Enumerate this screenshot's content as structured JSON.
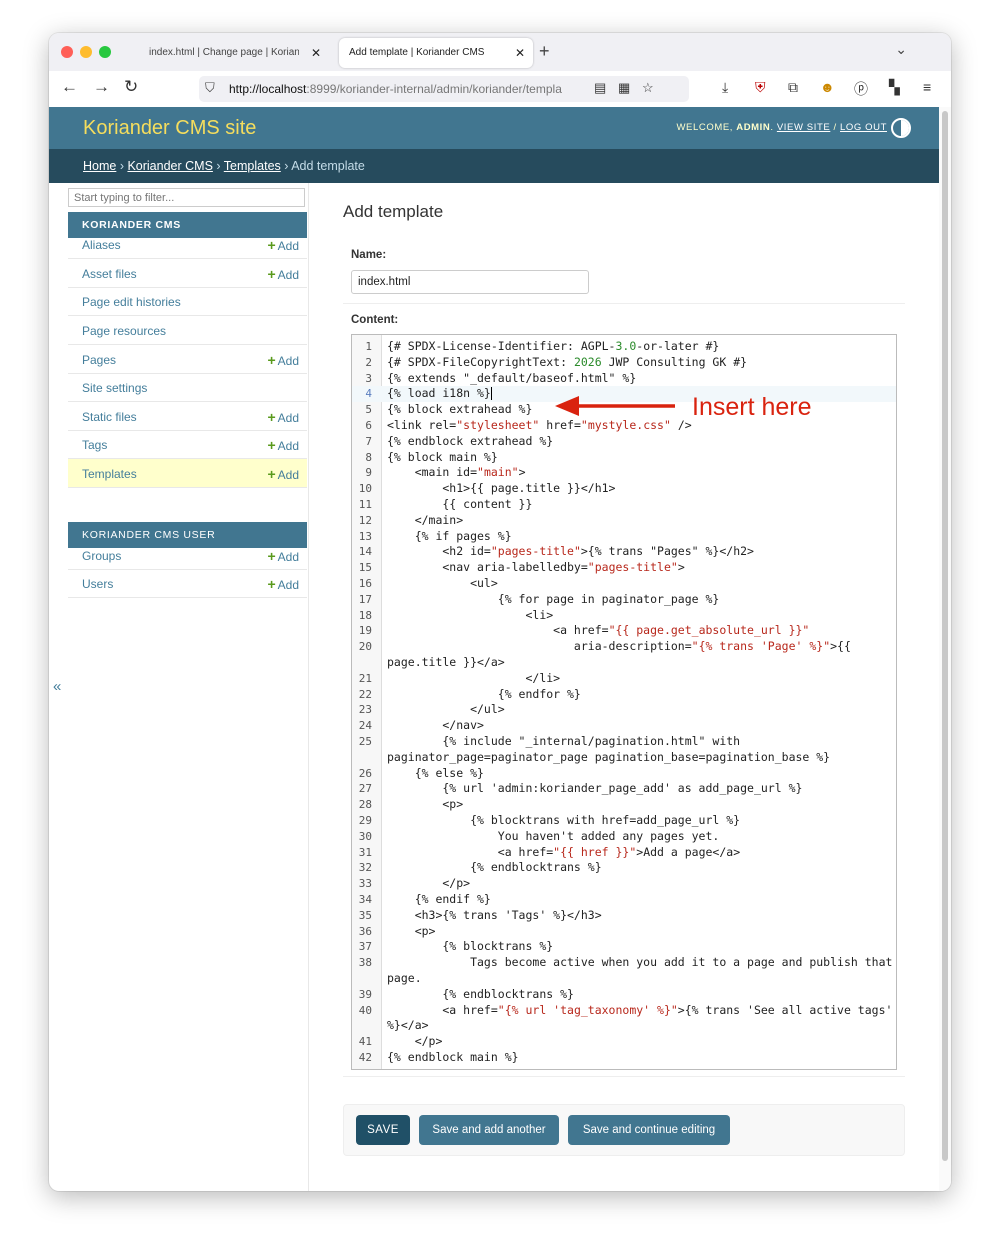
{
  "browser": {
    "tabs": [
      {
        "title": "index.html | Change page | Koriander CMS",
        "active": false
      },
      {
        "title": "Add template | Koriander CMS",
        "active": true
      }
    ],
    "url_host": "http://localhost",
    "url_rest": ":8999/koriander-internal/admin/koriander/templa"
  },
  "header": {
    "brand": "Koriander CMS site",
    "welcome": "WELCOME, ",
    "user": "ADMIN",
    "view_site": "VIEW SITE",
    "slash": " / ",
    "log_out": "LOG OUT"
  },
  "breadcrumbs": {
    "home": "Home",
    "app": "Koriander CMS",
    "model": "Templates",
    "sep": " › ",
    "current": "Add template"
  },
  "sidebar": {
    "filter_placeholder": "Start typing to filter...",
    "add_label": "Add",
    "sections": [
      {
        "caption": "KORIANDER CMS",
        "items": [
          {
            "name": "Aliases",
            "add": true
          },
          {
            "name": "Asset files",
            "add": true
          },
          {
            "name": "Page edit histories",
            "add": false
          },
          {
            "name": "Page resources",
            "add": false
          },
          {
            "name": "Pages",
            "add": true
          },
          {
            "name": "Site settings",
            "add": false
          },
          {
            "name": "Static files",
            "add": true
          },
          {
            "name": "Tags",
            "add": true
          },
          {
            "name": "Templates",
            "add": true,
            "active": true
          }
        ]
      },
      {
        "caption": "KORIANDER CMS USER",
        "items": [
          {
            "name": "Groups",
            "add": true
          },
          {
            "name": "Users",
            "add": true
          }
        ]
      }
    ],
    "collapse_icon": "«"
  },
  "main": {
    "title": "Add template",
    "name_label": "Name:",
    "name_value": "index.html",
    "content_label": "Content:",
    "cursor_line": 4,
    "code": [
      {
        "n": "1",
        "t": "{# SPDX-License-Identifier: AGPL-3.0-or-later #}"
      },
      {
        "n": "2",
        "t": "{# SPDX-FileCopyrightText: 2026 JWP Consulting GK #}"
      },
      {
        "n": "3",
        "t": "{% extends \"_default/baseof.html\" %}"
      },
      {
        "n": "4",
        "t": "{% load i18n %}"
      },
      {
        "n": "5",
        "t": "{% block extrahead %}"
      },
      {
        "n": "6",
        "t": "<link rel=\"stylesheet\" href=\"mystyle.css\" />"
      },
      {
        "n": "7",
        "t": "{% endblock extrahead %}"
      },
      {
        "n": "8",
        "t": "{% block main %}"
      },
      {
        "n": "9",
        "t": "    <main id=\"main\">"
      },
      {
        "n": "10",
        "t": "        <h1>{{ page.title }}</h1>"
      },
      {
        "n": "11",
        "t": "        {{ content }}"
      },
      {
        "n": "12",
        "t": "    </main>"
      },
      {
        "n": "13",
        "t": "    {% if pages %}"
      },
      {
        "n": "14",
        "t": "        <h2 id=\"pages-title\">{% trans \"Pages\" %}</h2>"
      },
      {
        "n": "15",
        "t": "        <nav aria-labelledby=\"pages-title\">"
      },
      {
        "n": "16",
        "t": "            <ul>"
      },
      {
        "n": "17",
        "t": "                {% for page in paginator_page %}"
      },
      {
        "n": "18",
        "t": "                    <li>"
      },
      {
        "n": "19",
        "t": "                        <a href=\"{{ page.get_absolute_url }}\""
      },
      {
        "n": "20",
        "t": "                           aria-description=\"{% trans 'Page' %}\">{{"
      },
      {
        "n": "",
        "t": "page.title }}</a>"
      },
      {
        "n": "21",
        "t": "                    </li>"
      },
      {
        "n": "22",
        "t": "                {% endfor %}"
      },
      {
        "n": "23",
        "t": "            </ul>"
      },
      {
        "n": "24",
        "t": "        </nav>"
      },
      {
        "n": "25",
        "t": "        {% include \"_internal/pagination.html\" with"
      },
      {
        "n": "",
        "t": "paginator_page=paginator_page pagination_base=pagination_base %}"
      },
      {
        "n": "26",
        "t": "    {% else %}"
      },
      {
        "n": "27",
        "t": "        {% url 'admin:koriander_page_add' as add_page_url %}"
      },
      {
        "n": "28",
        "t": "        <p>"
      },
      {
        "n": "29",
        "t": "            {% blocktrans with href=add_page_url %}"
      },
      {
        "n": "30",
        "t": "                You haven't added any pages yet."
      },
      {
        "n": "31",
        "t": "                <a href=\"{{ href }}\">Add a page</a>"
      },
      {
        "n": "32",
        "t": "            {% endblocktrans %}"
      },
      {
        "n": "33",
        "t": "        </p>"
      },
      {
        "n": "34",
        "t": "    {% endif %}"
      },
      {
        "n": "35",
        "t": "    <h3>{% trans 'Tags' %}</h3>"
      },
      {
        "n": "36",
        "t": "    <p>"
      },
      {
        "n": "37",
        "t": "        {% blocktrans %}"
      },
      {
        "n": "38",
        "t": "            Tags become active when you add it to a page and publish that"
      },
      {
        "n": "",
        "t": "page."
      },
      {
        "n": "39",
        "t": "        {% endblocktrans %}"
      },
      {
        "n": "40",
        "t": "        <a href=\"{% url 'tag_taxonomy' %}\">{% trans 'See all active tags'"
      },
      {
        "n": "",
        "t": "%}</a>"
      },
      {
        "n": "41",
        "t": "    </p>"
      },
      {
        "n": "42",
        "t": "{% endblock main %}"
      }
    ],
    "annotation": "Insert here"
  },
  "buttons": {
    "save": "SAVE",
    "save_add_another": "Save and add another",
    "save_continue": "Save and continue editing"
  },
  "colors": {
    "header_bg": "#417690",
    "breadcrumb_bg": "#264b5d",
    "brand_yellow": "#f5dd5d",
    "annotation_red": "#d9230f",
    "string_red": "#b8281c",
    "number_green": "#2a8a2a"
  }
}
